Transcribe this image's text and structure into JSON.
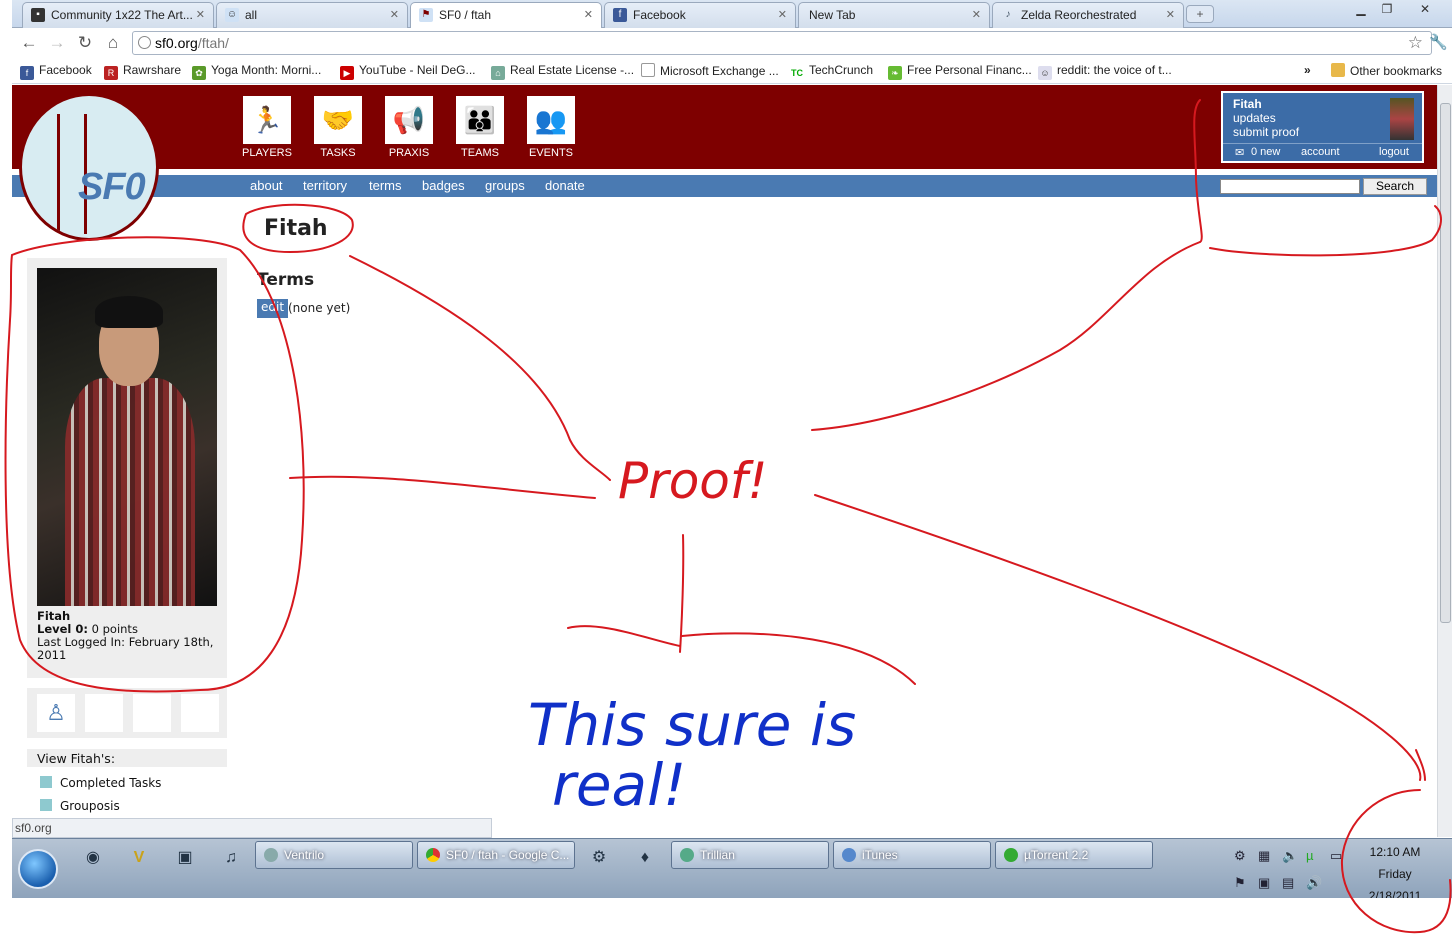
{
  "browser": {
    "tabs": [
      {
        "title": "Community 1x22 The Art...",
        "active": false
      },
      {
        "title": "all",
        "active": false
      },
      {
        "title": "SF0 / ftah",
        "active": true
      },
      {
        "title": "Facebook",
        "active": false
      },
      {
        "title": "New Tab",
        "active": false
      },
      {
        "title": "Zelda Reorchestrated",
        "active": false
      }
    ],
    "url_host": "sf0.org",
    "url_path": "/ftah/",
    "bookmarks": [
      "Facebook",
      "Rawrshare",
      "Yoga Month: Morni...",
      "YouTube - Neil DeG...",
      "Real Estate License -...",
      "Microsoft Exchange ...",
      "TechCrunch",
      "Free Personal Financ...",
      "reddit: the voice of t..."
    ],
    "other_bookmarks": "Other bookmarks",
    "status_url": "sf0.org"
  },
  "site": {
    "logo_text": "SF0",
    "nav_icons": [
      "PLAYERS",
      "TASKS",
      "PRAXIS",
      "TEAMS",
      "EVENTS"
    ],
    "menu": [
      "about",
      "territory",
      "terms",
      "badges",
      "groups",
      "donate"
    ],
    "search_button": "Search",
    "userbox": {
      "name": "Fitah",
      "link_updates": "updates",
      "link_submit": "submit proof",
      "messages": "0 new",
      "account": "account",
      "logout": "logout"
    }
  },
  "profile": {
    "page_title": "Fitah",
    "terms_heading": "Terms",
    "edit_label": "edit",
    "terms_value": "(none yet)",
    "name": "Fitah",
    "level_label": "Level 0:",
    "points": "0 points",
    "last_login": "Last Logged In: February 18th,",
    "last_login_year": "2011",
    "view_heading": "View Fitah's:",
    "view_links": [
      "Completed Tasks",
      "Grouposis"
    ]
  },
  "annotations": {
    "proof": "Proof!",
    "real_line1": "This sure is",
    "real_line2": "real!",
    "colors": {
      "red_ink": "#d6191f",
      "blue_ink": "#1030c8"
    }
  },
  "taskbar": {
    "tasks": [
      "Ventrilo",
      "SF0 / ftah - Google C...",
      "Trillian",
      "iTunes",
      "µTorrent 2.2"
    ],
    "clock_time": "12:10 AM",
    "clock_day": "Friday",
    "clock_date": "2/18/2011"
  },
  "colors": {
    "site_red": "#7e0000",
    "site_blue": "#4a7ab2",
    "badge_teal": "#8ec9cf"
  }
}
